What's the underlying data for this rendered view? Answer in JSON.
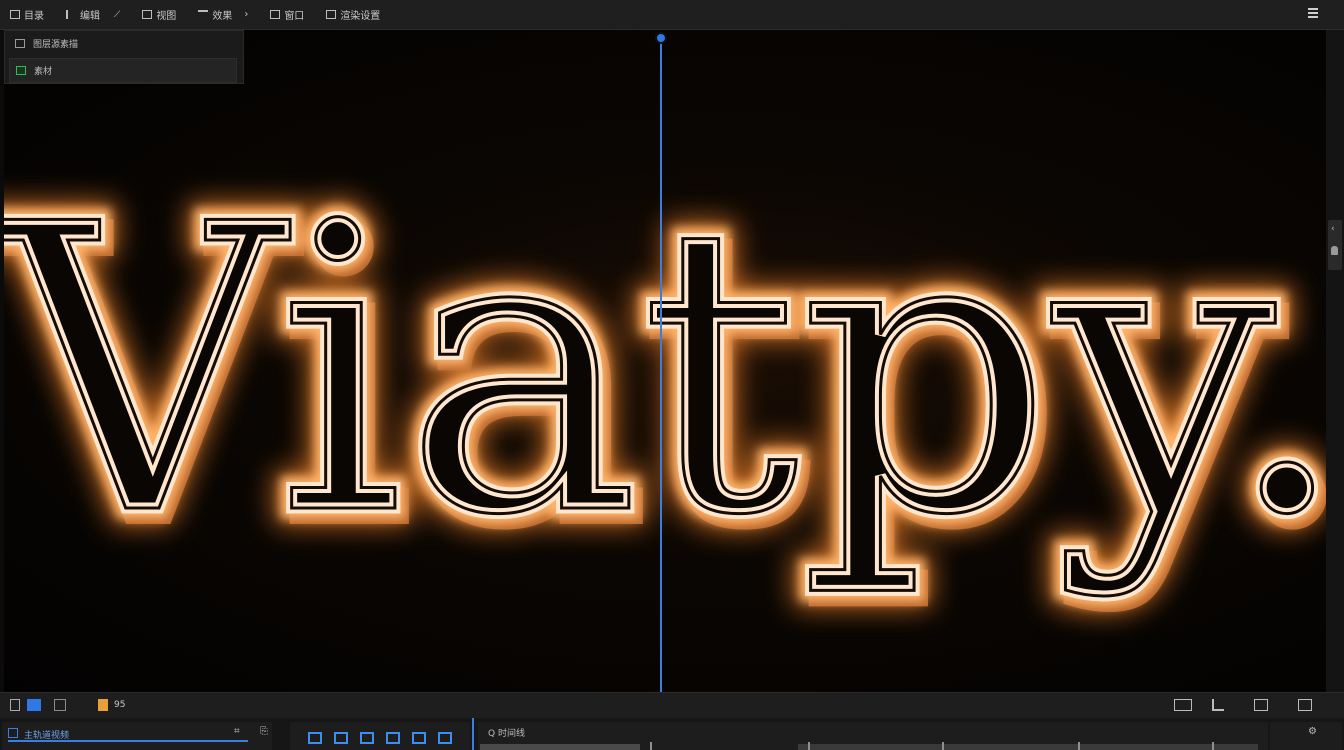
{
  "menu": {
    "items": [
      {
        "label": "目录",
        "icon": "layout-icon"
      },
      {
        "label": "编辑",
        "icon": "edit-icon"
      },
      {
        "label": "视图",
        "icon": "grid-icon"
      },
      {
        "label": "效果",
        "icon": "effects-icon"
      },
      {
        "label": "窗口",
        "icon": "window-icon"
      },
      {
        "label": "渲染设置",
        "icon": "render-icon"
      }
    ]
  },
  "layers": {
    "rows": [
      {
        "label": "图层源素描",
        "icon": "layer-icon"
      },
      {
        "label": "素材",
        "icon": "media-icon"
      }
    ]
  },
  "canvas": {
    "text": "Viatpy.",
    "glow_color": "#ffb36b",
    "core_color": "#fff2e4",
    "edge_color": "#f28c3c"
  },
  "status": {
    "left_label": "95"
  },
  "timeline": {
    "left_label": "主轨道视频",
    "track_label": "Q 时间线"
  },
  "colors": {
    "accent": "#3c7de0",
    "tool_orange": "#e7a03a"
  }
}
